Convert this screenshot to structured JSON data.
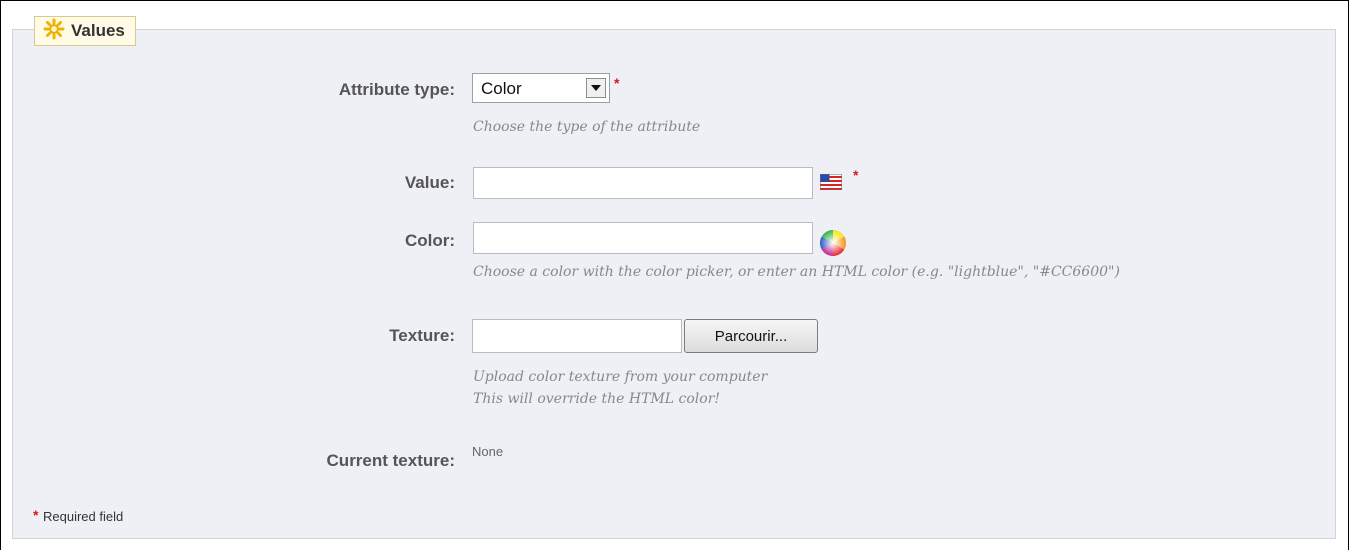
{
  "legend": {
    "title": "Values",
    "icon": "gear-star-icon"
  },
  "fields": {
    "attribute_type": {
      "label": "Attribute type:",
      "selected": "Color",
      "hint": "Choose the type of the attribute",
      "required_mark": "*"
    },
    "value": {
      "label": "Value:",
      "value": "",
      "required_mark": "*",
      "language_icon": "us-flag-icon"
    },
    "color": {
      "label": "Color:",
      "value": "",
      "picker_icon": "color-wheel-icon",
      "hint": "Choose a color with the color picker, or enter an HTML color (e.g. \"lightblue\", \"#CC6600\")"
    },
    "texture": {
      "label": "Texture:",
      "value": "",
      "button_label": "Parcourir...",
      "hint_line1": "Upload color texture from your computer",
      "hint_line2": "This will override the HTML color!"
    },
    "current_texture": {
      "label": "Current texture:",
      "value": "None"
    }
  },
  "footer": {
    "required_mark": "*",
    "required_note": "Required field"
  },
  "colors": {
    "panel_bg": "#eef0f6",
    "legend_bg": "#fffbe6",
    "required": "#d21c1c",
    "hint_text": "#888888"
  }
}
